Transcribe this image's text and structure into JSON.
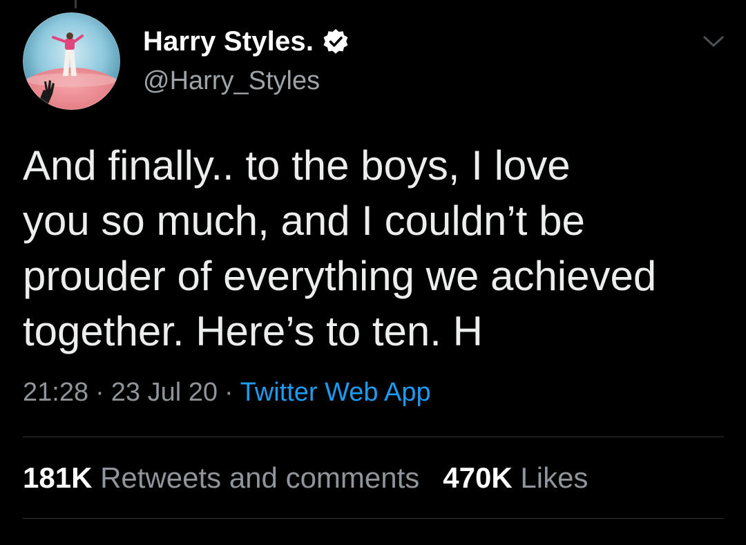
{
  "profile": {
    "display_name": "Harry Styles.",
    "handle": "@Harry_Styles",
    "verified": true,
    "avatar": "profile-photo"
  },
  "tweet": {
    "text": "And finally.. to the boys, I love\nyou so much, and I couldn’t be\nprouder of everything we achieved\ntogether. Here’s to ten. H",
    "time": "21:28",
    "date": "23 Jul 20",
    "separator": "·",
    "source": "Twitter Web App"
  },
  "stats": {
    "retweets_count": "181K",
    "retweets_label": "Retweets and comments",
    "likes_count": "470K",
    "likes_label": "Likes"
  },
  "icons": {
    "verified": "verified-badge-icon",
    "menu": "chevron-down-icon"
  },
  "colors": {
    "background": "#000000",
    "primary_text": "#ffffff",
    "secondary_text": "#8f959a",
    "link": "#1d9bf0"
  }
}
